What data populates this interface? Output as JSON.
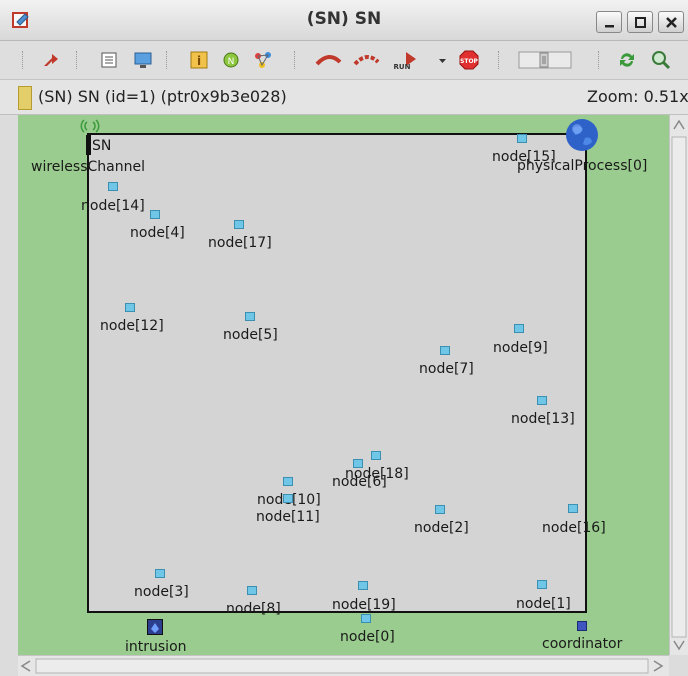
{
  "window": {
    "title": "(SN) SN",
    "controls": [
      "minimize",
      "maximize",
      "close"
    ]
  },
  "toolbar": {
    "buttons": [
      "go-up-icon",
      "list-view-icon",
      "display-icon",
      "info-icon",
      "object-icon",
      "layout-icon",
      "step-icon",
      "fast-icon",
      "run-icon",
      "run-dropdown-icon",
      "stop-icon",
      "speed-slider",
      "refresh-icon",
      "zoom-in-icon"
    ],
    "run_label": "RUN",
    "stop_label": "STOP"
  },
  "info": {
    "text": "(SN) SN  (id=1)  (ptr0x9b3e028)",
    "zoom": "Zoom: 0.51x"
  },
  "network": {
    "sn_label": "SN",
    "wireless_channel": "wirelessChannel",
    "physical_process": "physicalProcess[0]",
    "intrusion": "intrusion",
    "coordinator": "coordinator"
  },
  "nodes": [
    {
      "label": "node[0]"
    },
    {
      "label": "node[1]"
    },
    {
      "label": "node[2]"
    },
    {
      "label": "node[3]"
    },
    {
      "label": "node[4]"
    },
    {
      "label": "node[5]"
    },
    {
      "label": "node[6]"
    },
    {
      "label": "node[7]"
    },
    {
      "label": "node[8]"
    },
    {
      "label": "node[9]"
    },
    {
      "label": "node[10]"
    },
    {
      "label": "node[11]"
    },
    {
      "label": "node[12]"
    },
    {
      "label": "node[13]"
    },
    {
      "label": "node[14]"
    },
    {
      "label": "node[15]"
    },
    {
      "label": "node[16]"
    },
    {
      "label": "node[17]"
    },
    {
      "label": "node[18]"
    },
    {
      "label": "node[19]"
    }
  ],
  "colors": {
    "canvas_bg": "#99cc8e",
    "area_bg": "#d4d4d4",
    "node": "#6fc6e6",
    "stop": "#e03030"
  }
}
